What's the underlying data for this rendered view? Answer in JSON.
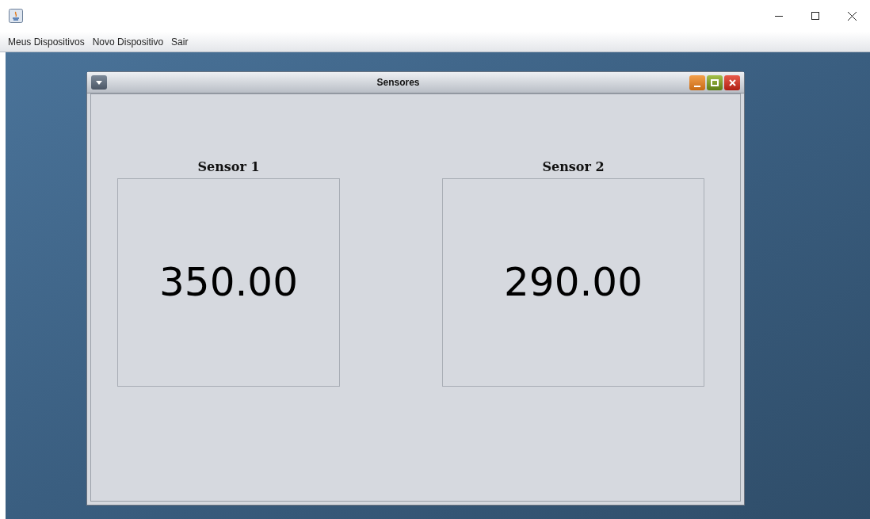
{
  "menu": [
    "Meus Dispositivos",
    "Novo Dispositivo",
    "Sair"
  ],
  "internal_frame": {
    "title": "Sensores"
  },
  "sensors": [
    {
      "label": "Sensor 1",
      "value": "350.00"
    },
    {
      "label": "Sensor 2",
      "value": "290.00"
    }
  ]
}
